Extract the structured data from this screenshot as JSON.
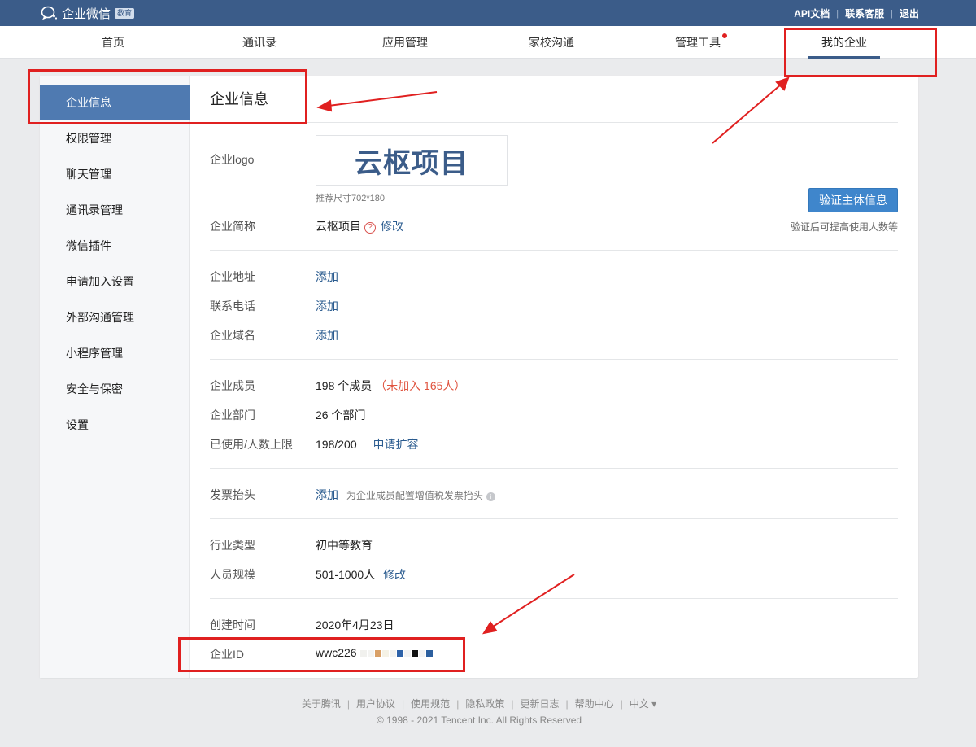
{
  "brand": {
    "name": "企业微信",
    "badge": "教育"
  },
  "toplinks": [
    "API文档",
    "联系客服",
    "退出"
  ],
  "nav": [
    {
      "label": "首页"
    },
    {
      "label": "通讯录"
    },
    {
      "label": "应用管理"
    },
    {
      "label": "家校沟通"
    },
    {
      "label": "管理工具",
      "dot": true
    },
    {
      "label": "我的企业",
      "active": true
    }
  ],
  "sidebar": [
    {
      "label": "企业信息",
      "active": true
    },
    {
      "label": "权限管理"
    },
    {
      "label": "聊天管理"
    },
    {
      "label": "通讯录管理"
    },
    {
      "label": "微信插件"
    },
    {
      "label": "申请加入设置"
    },
    {
      "label": "外部沟通管理"
    },
    {
      "label": "小程序管理"
    },
    {
      "label": "安全与保密"
    },
    {
      "label": "设置"
    }
  ],
  "page_title": "企业信息",
  "logo": {
    "label": "企业logo",
    "text": "云枢项目",
    "size_hint": "推荐尺寸702*180"
  },
  "verify": {
    "button": "验证主体信息",
    "tip": "验证后可提高使用人数等"
  },
  "short_name": {
    "label": "企业简称",
    "value": "云枢项目",
    "help_icon": "?",
    "action": "修改"
  },
  "address": {
    "label": "企业地址",
    "action": "添加"
  },
  "phone": {
    "label": "联系电话",
    "action": "添加"
  },
  "domain": {
    "label": "企业域名",
    "action": "添加"
  },
  "members": {
    "label": "企业成员",
    "value": "198 个成员",
    "note": "（未加入 165人）"
  },
  "departments": {
    "label": "企业部门",
    "value": "26 个部门"
  },
  "quota": {
    "label": "已使用/人数上限",
    "value": "198/200",
    "action": "申请扩容"
  },
  "invoice": {
    "label": "发票抬头",
    "action": "添加",
    "hint": "为企业成员配置增值税发票抬头",
    "info_icon": "i"
  },
  "industry": {
    "label": "行业类型",
    "value": "初中等教育"
  },
  "scale": {
    "label": "人员规模",
    "value": "501-1000人",
    "action": "修改"
  },
  "created": {
    "label": "创建时间",
    "value": "2020年4月23日"
  },
  "corp_id": {
    "label": "企业ID",
    "value": "wwc226"
  },
  "footer": {
    "links": [
      "关于腾讯",
      "用户协议",
      "使用规范",
      "隐私政策",
      "更新日志",
      "帮助中心",
      "中文 ▾"
    ],
    "copyright": "© 1998 - 2021 Tencent Inc. All Rights Reserved"
  },
  "colors": {
    "topbar": "#3b5c89",
    "accent": "#4f7ab1",
    "link": "#2a5b8f",
    "annotation": "#e02020"
  }
}
